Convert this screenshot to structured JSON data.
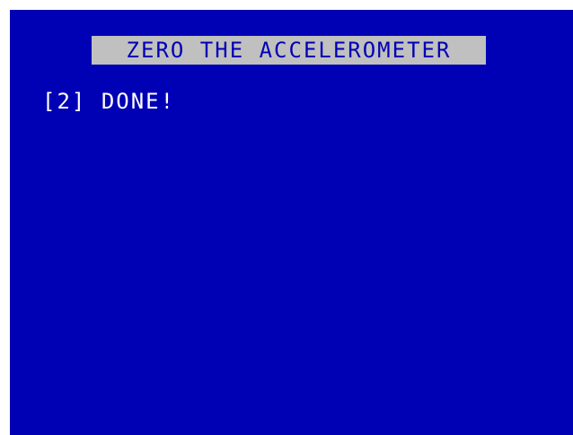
{
  "screen": {
    "background_color": "#0000b4",
    "title": "ZERO THE ACCELEROMETER",
    "title_bar_color": "#c0c0c0",
    "title_text_color": "#0000b4",
    "option": {
      "key": "[2]",
      "status": "DONE!"
    },
    "text_color": "#ffffff"
  }
}
